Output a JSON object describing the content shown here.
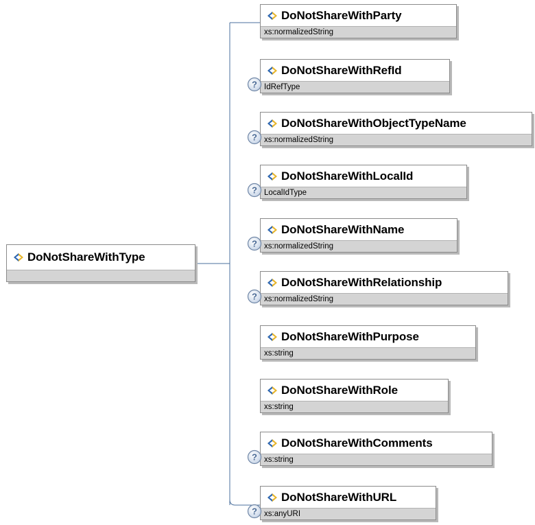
{
  "root": {
    "name": "DoNotShareWithType",
    "type": ""
  },
  "elements": [
    {
      "name": "DoNotShareWithParty",
      "type": "xs:normalizedString",
      "optional": false
    },
    {
      "name": "DoNotShareWithRefId",
      "type": "IdRefType",
      "optional": true
    },
    {
      "name": "DoNotShareWithObjectTypeName",
      "type": "xs:normalizedString",
      "optional": true
    },
    {
      "name": "DoNotShareWithLocalId",
      "type": "LocalIdType",
      "optional": true
    },
    {
      "name": "DoNotShareWithName",
      "type": "xs:normalizedString",
      "optional": true
    },
    {
      "name": "DoNotShareWithRelationship",
      "type": "xs:normalizedString",
      "optional": true
    },
    {
      "name": "DoNotShareWithPurpose",
      "type": "xs:string",
      "optional": false
    },
    {
      "name": "DoNotShareWithRole",
      "type": "xs:string",
      "optional": false
    },
    {
      "name": "DoNotShareWithComments",
      "type": "xs:string",
      "optional": true
    },
    {
      "name": "DoNotShareWithURL",
      "type": "xs:anyURI",
      "optional": true
    }
  ],
  "optional_badge": "?",
  "icons": {
    "element": "element-diamond-icon",
    "optional": "optional-question-icon"
  },
  "colors": {
    "icon_blue": "#2a66b8",
    "icon_gold": "#e7b52a",
    "line": "#4a6f9c",
    "type_band": "#d4d4d4"
  }
}
